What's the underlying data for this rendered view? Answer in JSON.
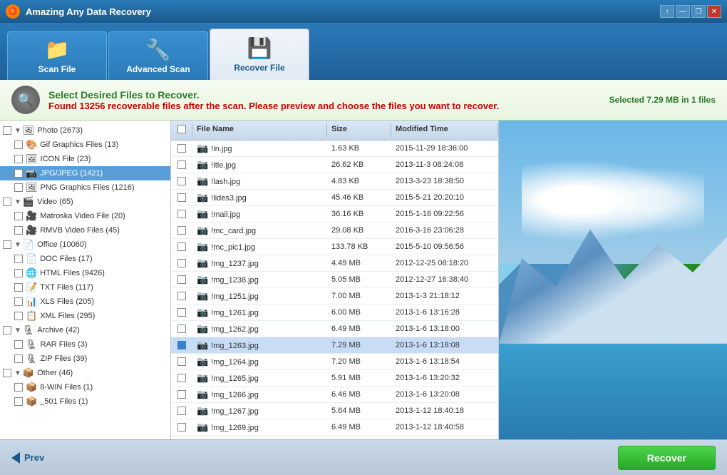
{
  "app": {
    "title": "Amazing Any Data Recovery",
    "logo_char": "A"
  },
  "titlebar": {
    "controls": [
      "↑",
      "—",
      "❐",
      "✕"
    ]
  },
  "tabs": [
    {
      "id": "scan-file",
      "label": "Scan File",
      "icon": "📁",
      "active": false
    },
    {
      "id": "advanced-scan",
      "label": "Advanced Scan",
      "icon": "🔧",
      "active": false
    },
    {
      "id": "recover-file",
      "label": "Recover File",
      "icon": "💾",
      "active": true
    }
  ],
  "infobar": {
    "title": "Select Desired Files to Recover.",
    "sub_prefix": "Found ",
    "count": "13256",
    "sub_suffix": " recoverable files after the scan. Please preview and choose the files you want to recover.",
    "selected_info": "Selected 7.29 MB in 1 files"
  },
  "tree": {
    "items": [
      {
        "id": "photo",
        "label": "Photo (2673)",
        "level": 0,
        "type": "category",
        "expanded": true,
        "checked": false,
        "icon": "🖼"
      },
      {
        "id": "gif",
        "label": "Gif Graphics Files (13)",
        "level": 1,
        "type": "sub",
        "checked": false,
        "icon": "🎨"
      },
      {
        "id": "icon",
        "label": "ICON File (23)",
        "level": 1,
        "type": "sub",
        "checked": false,
        "icon": "🖼"
      },
      {
        "id": "jpg",
        "label": "JPG/JPEG (1421)",
        "level": 1,
        "type": "sub",
        "checked": false,
        "icon": "📷",
        "selected": true
      },
      {
        "id": "png",
        "label": "PNG Graphics Files (1216)",
        "level": 1,
        "type": "sub",
        "checked": false,
        "icon": "🖼"
      },
      {
        "id": "video",
        "label": "Video (65)",
        "level": 0,
        "type": "category",
        "expanded": true,
        "checked": false,
        "icon": "🎬"
      },
      {
        "id": "matroska",
        "label": "Matroska Video File (20)",
        "level": 1,
        "type": "sub",
        "checked": false,
        "icon": "🎥"
      },
      {
        "id": "rmvb",
        "label": "RMVB Video Files (45)",
        "level": 1,
        "type": "sub",
        "checked": false,
        "icon": "🎥"
      },
      {
        "id": "office",
        "label": "Office (10060)",
        "level": 0,
        "type": "category",
        "expanded": true,
        "checked": false,
        "icon": "📄"
      },
      {
        "id": "doc",
        "label": "DOC Files (17)",
        "level": 1,
        "type": "sub",
        "checked": false,
        "icon": "📄"
      },
      {
        "id": "html",
        "label": "HTML Files (9426)",
        "level": 1,
        "type": "sub",
        "checked": false,
        "icon": "🌐"
      },
      {
        "id": "txt",
        "label": "TXT Files (117)",
        "level": 1,
        "type": "sub",
        "checked": false,
        "icon": "📝"
      },
      {
        "id": "xls",
        "label": "XLS Files (205)",
        "level": 1,
        "type": "sub",
        "checked": false,
        "icon": "📊"
      },
      {
        "id": "xml",
        "label": "XML Files (295)",
        "level": 1,
        "type": "sub",
        "checked": false,
        "icon": "📋"
      },
      {
        "id": "archive",
        "label": "Archive (42)",
        "level": 0,
        "type": "category",
        "expanded": true,
        "checked": false,
        "icon": "🗜"
      },
      {
        "id": "rar",
        "label": "RAR Files (3)",
        "level": 1,
        "type": "sub",
        "checked": false,
        "icon": "🗜"
      },
      {
        "id": "zip",
        "label": "ZIP Files (39)",
        "level": 1,
        "type": "sub",
        "checked": false,
        "icon": "🗜"
      },
      {
        "id": "other",
        "label": "Other (46)",
        "level": 0,
        "type": "category",
        "expanded": true,
        "checked": false,
        "icon": "📦"
      },
      {
        "id": "8win",
        "label": "8-WIN Files (1)",
        "level": 1,
        "type": "sub",
        "checked": false,
        "icon": "📦"
      },
      {
        "id": "501",
        "label": "_501 Files (1)",
        "level": 1,
        "type": "sub",
        "checked": false,
        "icon": "📦"
      }
    ]
  },
  "filelist": {
    "headers": [
      "",
      "File Name",
      "Size",
      "Modified Time"
    ],
    "rows": [
      {
        "id": 1,
        "name": "!in.jpg",
        "size": "1.63 KB",
        "time": "2015-11-29 18:36:00",
        "checked": false,
        "selected": false
      },
      {
        "id": 2,
        "name": "!itle.jpg",
        "size": "26.62 KB",
        "time": "2013-11-3 08:24:08",
        "checked": false,
        "selected": false
      },
      {
        "id": 3,
        "name": "!lash.jpg",
        "size": "4.83 KB",
        "time": "2013-3-23 18:38:50",
        "checked": false,
        "selected": false
      },
      {
        "id": 4,
        "name": "!lides3.jpg",
        "size": "45.46 KB",
        "time": "2015-5-21 20:20:10",
        "checked": false,
        "selected": false
      },
      {
        "id": 5,
        "name": "!mail.jpg",
        "size": "36.16 KB",
        "time": "2015-1-16 09:22:56",
        "checked": false,
        "selected": false
      },
      {
        "id": 6,
        "name": "!mc_card.jpg",
        "size": "29.08 KB",
        "time": "2016-3-16 23:06:28",
        "checked": false,
        "selected": false
      },
      {
        "id": 7,
        "name": "!mc_pic1.jpg",
        "size": "133.78 KB",
        "time": "2015-5-10 09:56:56",
        "checked": false,
        "selected": false
      },
      {
        "id": 8,
        "name": "!mg_1237.jpg",
        "size": "4.49 MB",
        "time": "2012-12-25 08:18:20",
        "checked": false,
        "selected": false
      },
      {
        "id": 9,
        "name": "!mg_1238.jpg",
        "size": "5.05 MB",
        "time": "2012-12-27 16:38:40",
        "checked": false,
        "selected": false
      },
      {
        "id": 10,
        "name": "!mg_1251.jpg",
        "size": "7.00 MB",
        "time": "2013-1-3 21:18:12",
        "checked": false,
        "selected": false
      },
      {
        "id": 11,
        "name": "!mg_1261.jpg",
        "size": "6.00 MB",
        "time": "2013-1-6 13:16:28",
        "checked": false,
        "selected": false
      },
      {
        "id": 12,
        "name": "!mg_1262.jpg",
        "size": "6.49 MB",
        "time": "2013-1-6 13:18:00",
        "checked": false,
        "selected": false
      },
      {
        "id": 13,
        "name": "!mg_1263.jpg",
        "size": "7.29 MB",
        "time": "2013-1-6 13:18:08",
        "checked": true,
        "selected": true
      },
      {
        "id": 14,
        "name": "!mg_1264.jpg",
        "size": "7.20 MB",
        "time": "2013-1-6 13:18:54",
        "checked": false,
        "selected": false
      },
      {
        "id": 15,
        "name": "!mg_1265.jpg",
        "size": "5.91 MB",
        "time": "2013-1-6 13:20:32",
        "checked": false,
        "selected": false
      },
      {
        "id": 16,
        "name": "!mg_1266.jpg",
        "size": "6.46 MB",
        "time": "2013-1-6 13:20:08",
        "checked": false,
        "selected": false
      },
      {
        "id": 17,
        "name": "!mg_1267.jpg",
        "size": "5.64 MB",
        "time": "2013-1-12 18:40:18",
        "checked": false,
        "selected": false
      },
      {
        "id": 18,
        "name": "!mg_1269.jpg",
        "size": "6.49 MB",
        "time": "2013-1-12 18:40:58",
        "checked": false,
        "selected": false
      }
    ]
  },
  "bottombar": {
    "prev_label": "Prev",
    "recover_label": "Recover"
  }
}
